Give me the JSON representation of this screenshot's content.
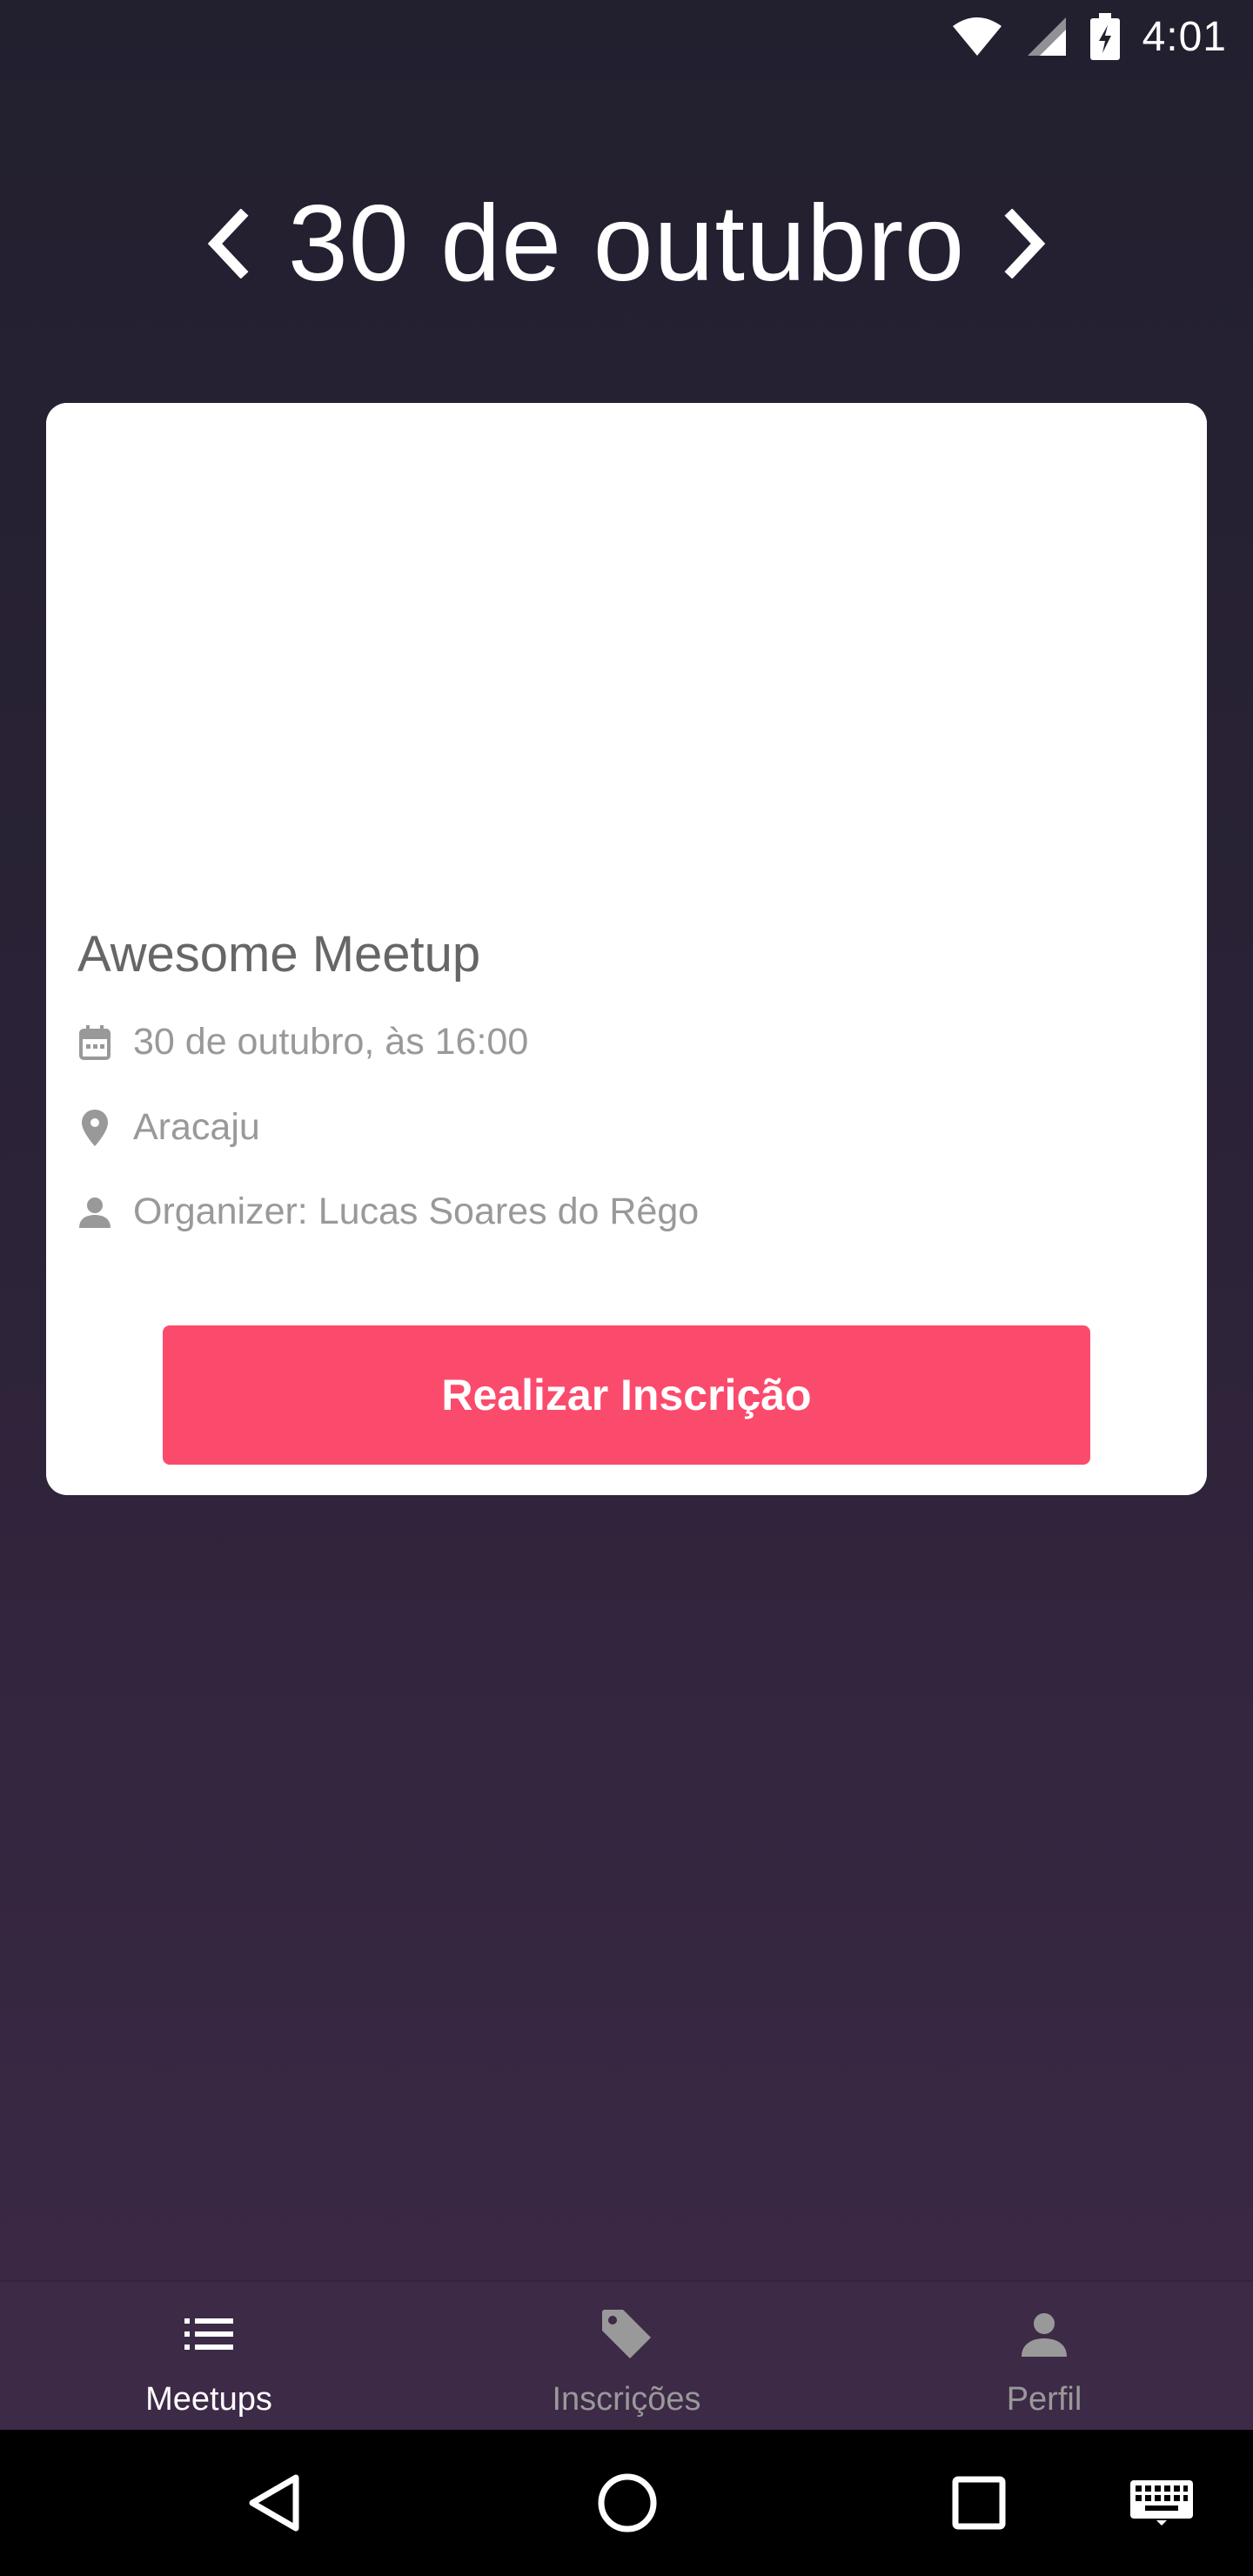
{
  "status_bar": {
    "time": "4:01"
  },
  "header": {
    "title": "30 de outubro"
  },
  "meetup": {
    "title": "Awesome Meetup",
    "date": "30 de outubro, às 16:00",
    "location": "Aracaju",
    "organizer": "Organizer: Lucas Soares do Rêgo",
    "subscribe_label": "Realizar Inscrição"
  },
  "tabs": [
    {
      "label": "Meetups",
      "icon": "list-icon",
      "active": true
    },
    {
      "label": "Inscrições",
      "icon": "tag-icon",
      "active": false
    },
    {
      "label": "Perfil",
      "icon": "person-icon",
      "active": false
    }
  ],
  "colors": {
    "accent": "#fb4b6d",
    "background_top": "#22202f",
    "background_bottom": "#3e2a48",
    "tab_bar": "#3d2a47"
  }
}
